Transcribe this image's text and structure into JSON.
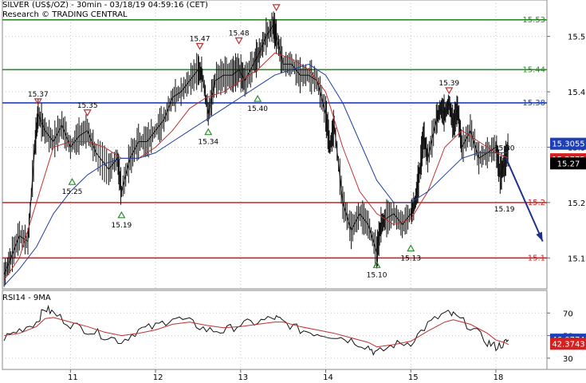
{
  "chart_data": {
    "type": "line",
    "title": "SILVER (US$/OZ) - 30min - 03/18/19 04:59:16 (CET)",
    "subtitle": "Research © TRADING CENTRAL",
    "price_axis": {
      "ylim": [
        15.05,
        15.56
      ],
      "ticks": [
        "15.5",
        "15.4",
        "15.3",
        "15.2",
        "15.1"
      ],
      "tick_values": [
        15.5,
        15.4,
        15.3,
        15.2,
        15.1
      ]
    },
    "x_axis": {
      "tick_labels": [
        "11",
        "12",
        "13",
        "14",
        "15",
        "18"
      ],
      "tick_x": [
        -1,
        0,
        1,
        2,
        3,
        4
      ],
      "xlim": [
        -1.8,
        4.6
      ]
    },
    "levels": [
      {
        "label": "15.53",
        "value": 15.53,
        "color": "#2e8b2e"
      },
      {
        "label": "15.44",
        "value": 15.44,
        "color": "#2e8b2e"
      },
      {
        "label": "15.38",
        "value": 15.38,
        "color": "#1f3fb5"
      },
      {
        "label": "15.2",
        "value": 15.2,
        "color": "#d42020"
      },
      {
        "label": "15.1",
        "value": 15.1,
        "color": "#d42020"
      }
    ],
    "price_badges": [
      {
        "label": "15.3055",
        "value": 15.3055,
        "bg": "#1f3fb5"
      },
      {
        "label": "15.2775",
        "value": 15.2775,
        "bg": "#d42020"
      },
      {
        "label": "15.27",
        "value": 15.27,
        "bg": "#000000"
      }
    ],
    "swing_labels": [
      {
        "label": "15.37",
        "x": -1.38,
        "value": 15.37,
        "kind": "high"
      },
      {
        "label": "15.35",
        "x": -0.8,
        "value": 15.35,
        "kind": "high"
      },
      {
        "label": "15.25",
        "x": -0.98,
        "value": 15.25,
        "kind": "low"
      },
      {
        "label": "15.19",
        "x": -0.4,
        "value": 15.19,
        "kind": "low"
      },
      {
        "label": "15.47",
        "x": 0.52,
        "value": 15.47,
        "kind": "high"
      },
      {
        "label": "15.48",
        "x": 0.98,
        "value": 15.48,
        "kind": "high"
      },
      {
        "label": "15.34",
        "x": 0.62,
        "value": 15.34,
        "kind": "low"
      },
      {
        "label": "15.40",
        "x": 1.2,
        "value": 15.4,
        "kind": "low"
      },
      {
        "label": "",
        "x": 1.42,
        "value": 15.54,
        "kind": "high"
      },
      {
        "label": "15.10",
        "x": 2.6,
        "value": 15.1,
        "kind": "low"
      },
      {
        "label": "15.13",
        "x": 3.0,
        "value": 15.13,
        "kind": "low"
      },
      {
        "label": "15.39",
        "x": 3.45,
        "value": 15.39,
        "kind": "high"
      },
      {
        "label": "15.30",
        "x": 4.1,
        "value": 15.3,
        "kind": "note"
      },
      {
        "label": "15.19",
        "x": 4.1,
        "value": 15.19,
        "kind": "note"
      }
    ],
    "forecast_arrow": {
      "from": [
        4.12,
        15.28
      ],
      "to": [
        4.55,
        15.13
      ],
      "color": "#1f2f8f"
    },
    "price_series": {
      "name": "",
      "x": [
        -1.78,
        -1.7,
        -1.6,
        -1.5,
        -1.42,
        -1.38,
        -1.3,
        -1.2,
        -1.1,
        -1.0,
        -0.9,
        -0.8,
        -0.7,
        -0.55,
        -0.45,
        -0.4,
        -0.3,
        -0.2,
        -0.1,
        0.0,
        0.1,
        0.2,
        0.3,
        0.4,
        0.5,
        0.55,
        0.62,
        0.7,
        0.8,
        0.9,
        0.98,
        1.05,
        1.15,
        1.22,
        1.3,
        1.38,
        1.42,
        1.5,
        1.6,
        1.7,
        1.8,
        1.9,
        2.0,
        2.05,
        2.1,
        2.2,
        2.3,
        2.4,
        2.5,
        2.6,
        2.65,
        2.7,
        2.8,
        2.9,
        3.0,
        3.05,
        3.1,
        3.15,
        3.2,
        3.3,
        3.35,
        3.4,
        3.45,
        3.5,
        3.55,
        3.6,
        3.7,
        3.8,
        3.9,
        4.0,
        4.05,
        4.1,
        4.15
      ],
      "y": [
        15.07,
        15.1,
        15.14,
        15.13,
        15.3,
        15.36,
        15.33,
        15.31,
        15.34,
        15.3,
        15.32,
        15.33,
        15.29,
        15.26,
        15.28,
        15.22,
        15.28,
        15.31,
        15.31,
        15.33,
        15.35,
        15.39,
        15.4,
        15.42,
        15.44,
        15.43,
        15.36,
        15.42,
        15.43,
        15.43,
        15.44,
        15.42,
        15.45,
        15.47,
        15.5,
        15.52,
        15.5,
        15.45,
        15.45,
        15.43,
        15.43,
        15.42,
        15.36,
        15.3,
        15.34,
        15.2,
        15.15,
        15.18,
        15.16,
        15.11,
        15.16,
        15.17,
        15.18,
        15.16,
        15.18,
        15.2,
        15.25,
        15.32,
        15.28,
        15.35,
        15.37,
        15.36,
        15.38,
        15.34,
        15.37,
        15.3,
        15.33,
        15.28,
        15.29,
        15.3,
        15.25,
        15.27,
        15.3
      ]
    },
    "ma_fast": {
      "color": "#c03030",
      "x": [
        -1.78,
        -1.6,
        -1.4,
        -1.2,
        -1.0,
        -0.8,
        -0.6,
        -0.4,
        -0.2,
        0.0,
        0.2,
        0.4,
        0.6,
        0.8,
        1.0,
        1.2,
        1.4,
        1.6,
        1.8,
        2.0,
        2.2,
        2.4,
        2.6,
        2.8,
        3.0,
        3.2,
        3.4,
        3.6,
        3.8,
        4.0,
        4.15
      ],
      "y": [
        15.06,
        15.1,
        15.2,
        15.3,
        15.31,
        15.31,
        15.3,
        15.28,
        15.28,
        15.3,
        15.33,
        15.37,
        15.39,
        15.4,
        15.42,
        15.44,
        15.47,
        15.46,
        15.44,
        15.4,
        15.3,
        15.22,
        15.18,
        15.16,
        15.17,
        15.22,
        15.3,
        15.33,
        15.31,
        15.29,
        15.28
      ]
    },
    "ma_slow": {
      "color": "#1f3f9f",
      "x": [
        -1.78,
        -1.6,
        -1.4,
        -1.2,
        -1.0,
        -0.8,
        -0.6,
        -0.4,
        -0.2,
        0.0,
        0.2,
        0.4,
        0.6,
        0.8,
        1.0,
        1.2,
        1.4,
        1.6,
        1.8,
        2.0,
        2.2,
        2.4,
        2.6,
        2.8,
        3.0,
        3.2,
        3.4,
        3.6,
        3.8,
        4.0,
        4.15
      ],
      "y": [
        15.05,
        15.08,
        15.12,
        15.18,
        15.22,
        15.25,
        15.27,
        15.28,
        15.28,
        15.29,
        15.31,
        15.33,
        15.35,
        15.37,
        15.39,
        15.41,
        15.43,
        15.44,
        15.45,
        15.43,
        15.38,
        15.31,
        15.24,
        15.2,
        15.2,
        15.22,
        15.25,
        15.28,
        15.29,
        15.29,
        15.29
      ]
    },
    "rsi": {
      "title": "RSI14 - 9MA",
      "ylim": [
        20,
        90
      ],
      "ticks": [
        "70",
        "50",
        "30"
      ],
      "tick_values": [
        70,
        50,
        30
      ],
      "badges": [
        {
          "label": "46.0774",
          "value": 46.0774,
          "bg": "#1f3fb5"
        },
        {
          "label": "42.3743",
          "value": 42.3743,
          "bg": "#d42020"
        }
      ],
      "x": [
        -1.78,
        -1.6,
        -1.4,
        -1.3,
        -1.2,
        -1.0,
        -0.8,
        -0.6,
        -0.4,
        -0.2,
        0.0,
        0.2,
        0.4,
        0.6,
        0.8,
        1.0,
        1.2,
        1.4,
        1.5,
        1.7,
        1.9,
        2.1,
        2.3,
        2.5,
        2.6,
        2.8,
        3.0,
        3.2,
        3.4,
        3.5,
        3.7,
        3.9,
        4.0,
        4.1,
        4.15
      ],
      "y": [
        48,
        55,
        62,
        74,
        70,
        60,
        55,
        50,
        45,
        55,
        58,
        66,
        62,
        55,
        54,
        60,
        62,
        66,
        62,
        55,
        52,
        50,
        46,
        40,
        34,
        42,
        44,
        60,
        70,
        68,
        58,
        44,
        40,
        43,
        46
      ],
      "ma_y": [
        50,
        52,
        58,
        65,
        66,
        62,
        58,
        53,
        50,
        52,
        55,
        60,
        62,
        59,
        57,
        58,
        60,
        62,
        62,
        58,
        55,
        52,
        48,
        44,
        40,
        42,
        45,
        54,
        62,
        64,
        60,
        52,
        46,
        44,
        42
      ]
    }
  }
}
